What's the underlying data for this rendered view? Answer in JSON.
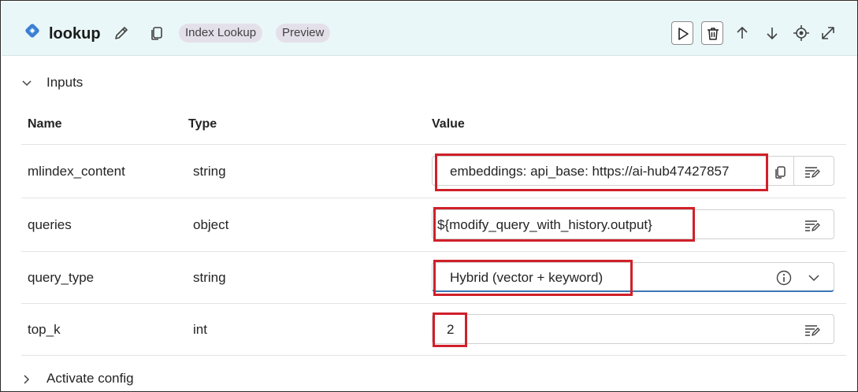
{
  "node": {
    "title": "lookup",
    "badges": [
      "Index Lookup",
      "Preview"
    ]
  },
  "inputs_section": {
    "label": "Inputs",
    "expanded": true
  },
  "table": {
    "headers": {
      "name": "Name",
      "type": "Type",
      "value": "Value"
    },
    "rows": [
      {
        "name": "mlindex_content",
        "type": "string",
        "value": "embeddings:  api_base: https://ai-hub47427857"
      },
      {
        "name": "queries",
        "type": "object",
        "value": "${modify_query_with_history.output}"
      },
      {
        "name": "query_type",
        "type": "string",
        "value": "Hybrid (vector + keyword)"
      },
      {
        "name": "top_k",
        "type": "int",
        "value": "2"
      }
    ]
  },
  "activate_section": {
    "label": "Activate config",
    "expanded": false
  },
  "colors": {
    "header_bg": "#eaf7f8",
    "highlight": "#d0202a",
    "accent_underline": "#3a76b5",
    "node_icon": "#3b7fd4"
  },
  "icons": {
    "node": "node-type-icon",
    "edit": "pencil-icon",
    "copy": "copy-icon",
    "run": "play-icon",
    "delete": "trash-icon",
    "up": "arrow-up-icon",
    "down": "arrow-down-icon",
    "locate": "target-icon",
    "expand": "expand-icon",
    "info": "info-icon",
    "dropdown": "chevron-down-icon",
    "prompt": "text-edit-icon"
  }
}
